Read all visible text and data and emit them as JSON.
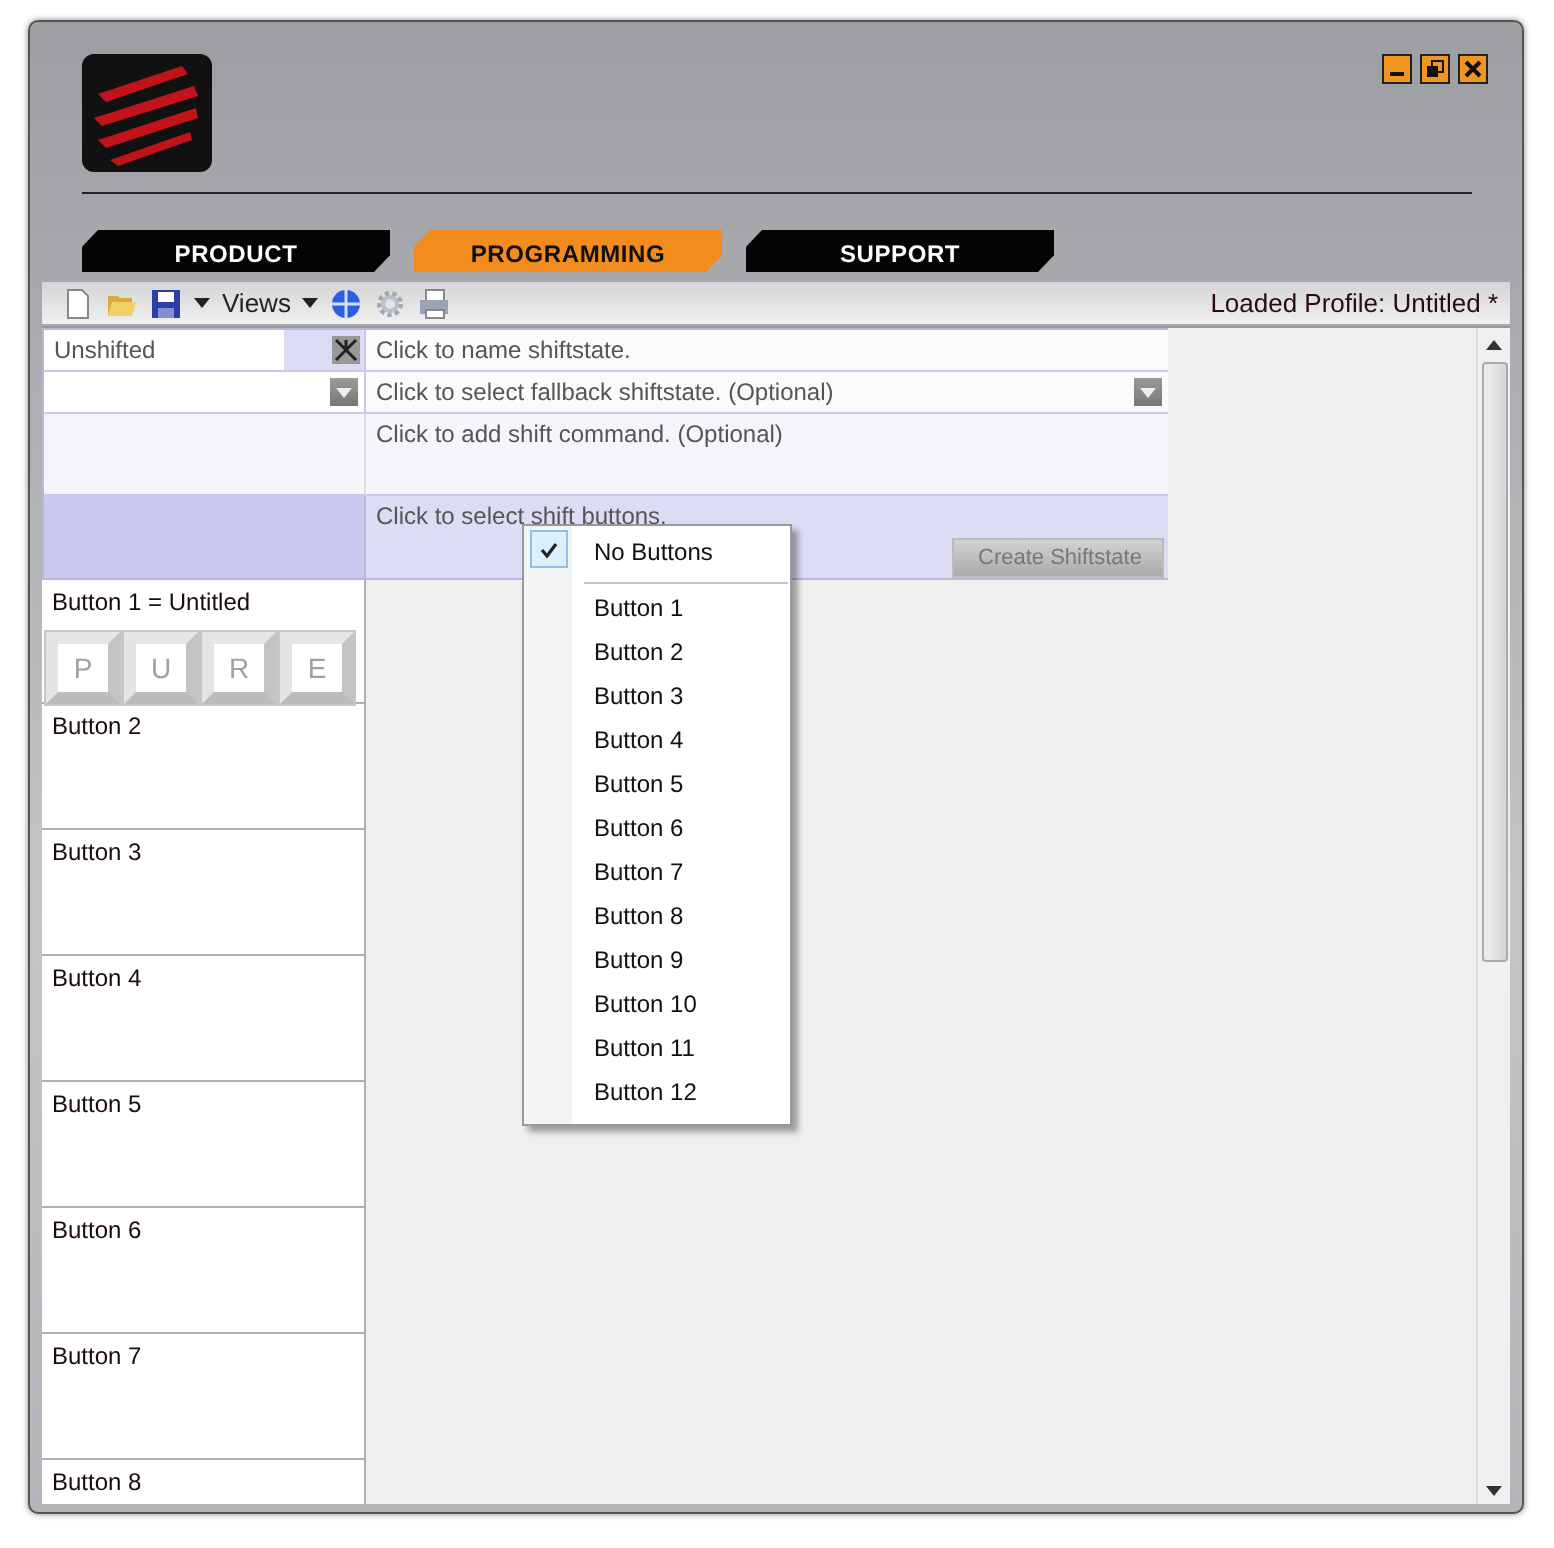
{
  "tabs": [
    {
      "label": "PRODUCT",
      "selected": false
    },
    {
      "label": "PROGRAMMING",
      "selected": true
    },
    {
      "label": "SUPPORT",
      "selected": false
    }
  ],
  "toolbar": {
    "views_label": "Views",
    "profile_status": "Loaded Profile: Untitled *"
  },
  "shiftstate": {
    "current": "Unshifted",
    "name_placeholder": "Click to name shiftstate.",
    "fallback_placeholder": "Click to select fallback shiftstate. (Optional)",
    "command_placeholder": "Click to add shift command. (Optional)",
    "buttons_placeholder": "Click to select shift buttons.",
    "create_button": {
      "label": "Create Shiftstate",
      "disabled": true
    }
  },
  "button_list": [
    {
      "label": "Button 1 = Untitled",
      "keys": [
        "P",
        "U",
        "R",
        "E"
      ]
    },
    {
      "label": "Button 2"
    },
    {
      "label": "Button 3"
    },
    {
      "label": "Button 4"
    },
    {
      "label": "Button 5"
    },
    {
      "label": "Button 6"
    },
    {
      "label": "Button 7"
    },
    {
      "label": "Button 8"
    }
  ],
  "shift_buttons_menu": {
    "none_option": {
      "label": "No Buttons",
      "checked": true
    },
    "items": [
      {
        "label": "Button 1",
        "checked": false
      },
      {
        "label": "Button 2",
        "checked": false
      },
      {
        "label": "Button 3",
        "checked": false
      },
      {
        "label": "Button 4",
        "checked": false
      },
      {
        "label": "Button 5",
        "checked": false
      },
      {
        "label": "Button 6",
        "checked": false
      },
      {
        "label": "Button 7",
        "checked": false
      },
      {
        "label": "Button 8",
        "checked": false
      },
      {
        "label": "Button 9",
        "checked": false
      },
      {
        "label": "Button 10",
        "checked": false
      },
      {
        "label": "Button 11",
        "checked": false
      },
      {
        "label": "Button 12",
        "checked": false
      }
    ]
  }
}
